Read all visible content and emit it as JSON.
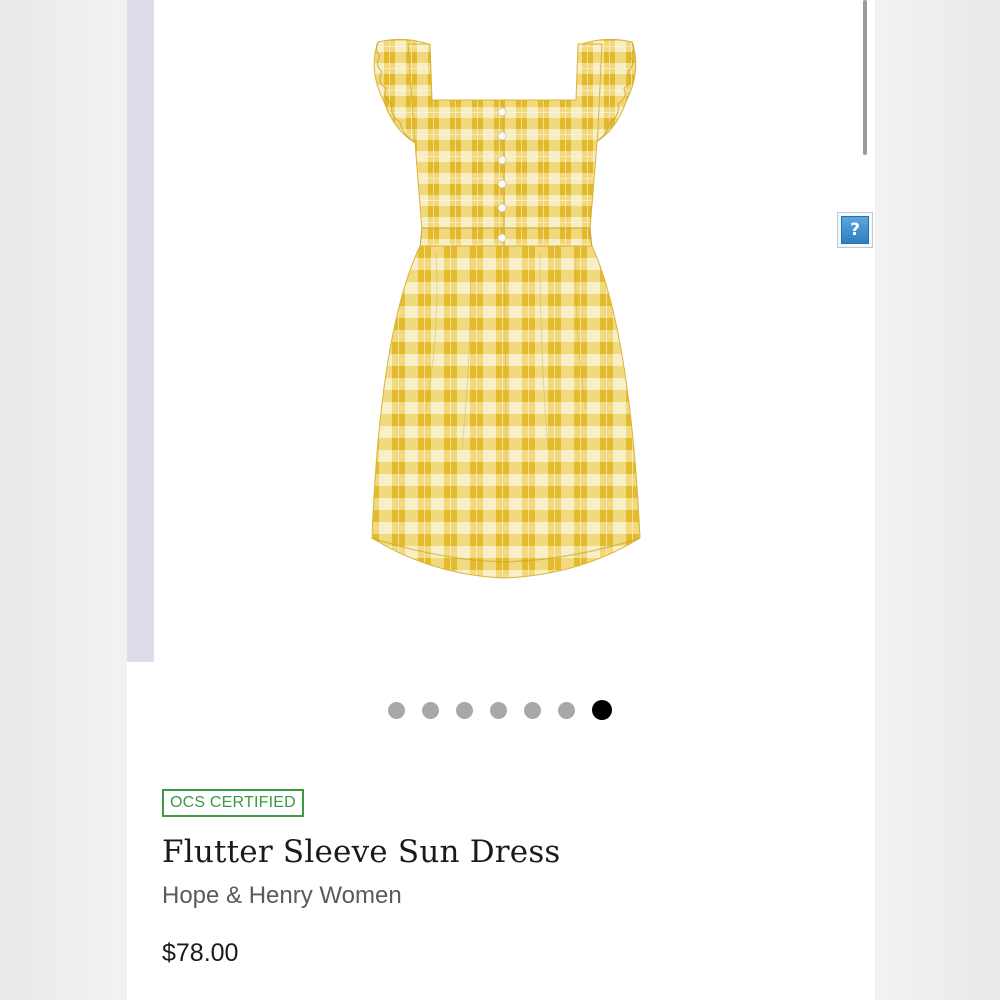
{
  "product": {
    "badge": "OCS CERTIFIED",
    "title": "Flutter Sleeve Sun Dress",
    "brand": "Hope & Henry Women",
    "price": "$78.00"
  },
  "gallery": {
    "total_images": 7,
    "active_index": 7,
    "image_icon": "yellow-gingham-dress"
  },
  "help_button": {
    "label": "?"
  },
  "colors": {
    "badge_green": "#3a9a45",
    "dress_yellow": "#ecc83e",
    "active_dot": "#000000",
    "inactive_dot": "#a8a8a8"
  }
}
